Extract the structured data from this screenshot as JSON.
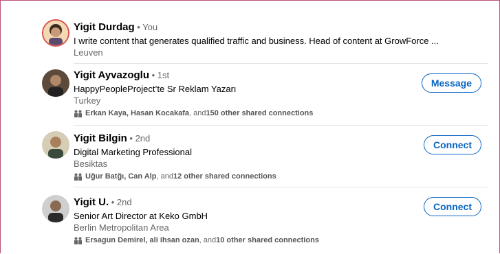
{
  "people": [
    {
      "name": "Yigit Durdag",
      "degree": "You",
      "headline": "I write content that generates qualified traffic and business. Head of content at GrowForce ...",
      "location": "Leuven"
    },
    {
      "name": "Yigit Ayvazoglu",
      "degree": "1st",
      "headline": "HappyPeopleProject’te Sr Reklam Yazarı",
      "location": "Turkey",
      "shared_names": "Erkan Kaya, Hasan Kocakafa",
      "shared_mid": ", and ",
      "shared_count": "150 other shared connections",
      "action": "Message"
    },
    {
      "name": "Yigit Bilgin",
      "degree": "2nd",
      "headline": "Digital Marketing Professional",
      "location": "Besiktas",
      "shared_names": "Uğur Batğı, Can Alp",
      "shared_mid": ", and ",
      "shared_count": "12 other shared connections",
      "action": "Connect"
    },
    {
      "name": "Yigit U.",
      "degree": "2nd",
      "headline": "Senior Art Director at Keko GmbH",
      "location": "Berlin Metropolitan Area",
      "shared_names": "Ersagun Demirel, ali ihsan ozan",
      "shared_mid": ", and ",
      "shared_count": "10 other shared connections",
      "action": "Connect"
    }
  ],
  "separator": " • ",
  "colors": {
    "accent": "#0a66c2",
    "muted": "#666666",
    "divider": "#e5e5e5"
  },
  "icons": {
    "shared": "people-icon"
  }
}
